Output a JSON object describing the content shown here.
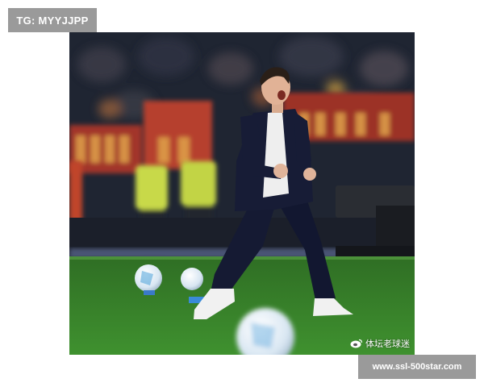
{
  "watermark_top": "TG: MYYJJPP",
  "photo": {
    "credit_text": "体坛老球迷",
    "credit_icon": "weibo-icon",
    "subject": "celebrating-coach"
  },
  "watermark_bottom": "www.ssl-500star.com",
  "colors": {
    "pitch": "#3c8a2c",
    "suit": "#151a33",
    "banner": "#a2362a"
  }
}
